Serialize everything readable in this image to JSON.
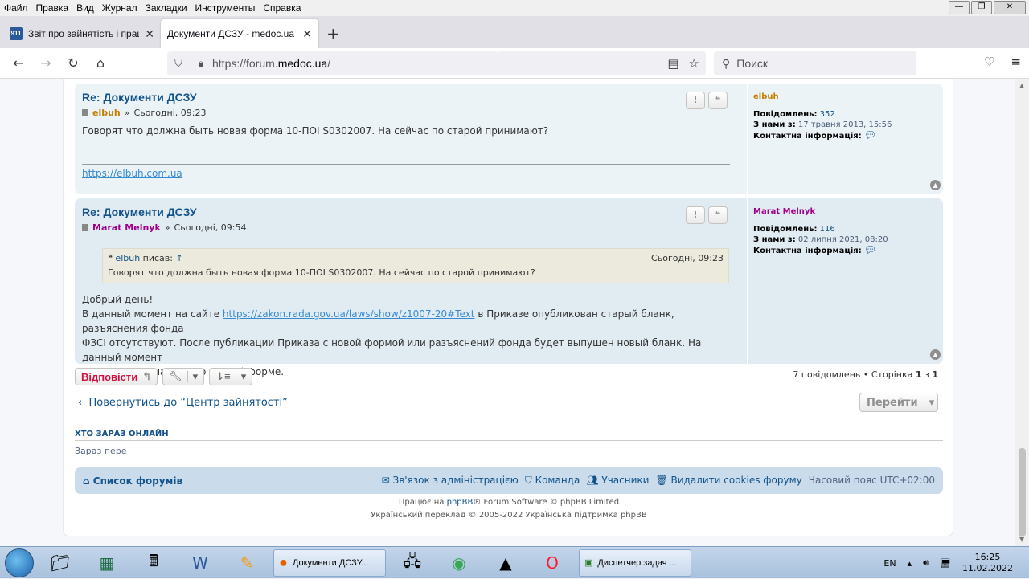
{
  "menu": [
    "Файл",
    "Правка",
    "Вид",
    "Журнал",
    "Закладки",
    "Инструменты",
    "Справка"
  ],
  "tabs": [
    {
      "title": "Звіт про зайнятість і працевла",
      "favicon": "911"
    },
    {
      "title": "Документи ДСЗУ - medoc.ua",
      "favicon": "M"
    }
  ],
  "url": {
    "prefix": "https://forum.",
    "domain": "medoc.ua",
    "suffix": "/"
  },
  "search_placeholder": "Поиск",
  "posts": [
    {
      "title": "Re: Документи ДСЗУ",
      "author": "elbuh",
      "author_color": "#c47d00",
      "date": "Сьогодні, 09:23",
      "body": "Говорят что должна быть новая форма 10-ПОІ S0302007. На сейчас по старой принимают?",
      "signature": "https://elbuh.com.ua",
      "profile": {
        "name": "elbuh",
        "posts_label": "Повідомлень:",
        "posts": "352",
        "since_label": "З нами з:",
        "since": "17 травня 2013, 15:56",
        "contact_label": "Контактна інформація:"
      }
    },
    {
      "title": "Re: Документи ДСЗУ",
      "author": "Marat Melnyk",
      "author_color": "#a0008a",
      "date": "Сьогодні, 09:54",
      "quote": {
        "author": "elbuh",
        "wrote": "писав:",
        "arrow": "↑",
        "date": "Сьогодні, 09:23",
        "text": "Говорят что должна быть новая форма 10-ПОІ S0302007. На сейчас по старой принимают?"
      },
      "body1": "Добрый день!",
      "body2_pre": "В данный момент на сайте ",
      "body2_link": "https://zakon.rada.gov.ua/laws/show/z1007-20#Text",
      "body2_post": " в Приказе опубликован старый бланк, разъяснения фонда",
      "body3": "ФЗСІ отсутствуют. После публикации Приказа с новой формой или разъяснений фонда будет выпущен новый бланк. На данный момент",
      "body4": "отчеты принимаются по старой форме.",
      "profile": {
        "name": "Marat Melnyk",
        "posts_label": "Повідомлень:",
        "posts": "116",
        "since_label": "З нами з:",
        "since": "02 липня 2021, 08:20",
        "contact_label": "Контактна інформація:"
      }
    }
  ],
  "reply_label": "Відповісти",
  "pager": {
    "count": "7 повідомлень",
    "sep": "•",
    "page_label": "Сторінка",
    "cur": "1",
    "of": "з",
    "total": "1"
  },
  "back_label": "Повернутись до “Центр зайнятості”",
  "goto_label": "Перейти",
  "online_title": "ХТО ЗАРАЗ ОНЛАЙН",
  "online_text": "Зараз пере",
  "footer_nav": {
    "index": "Список форумів",
    "contact": "Зв'язок з адміністрацією",
    "team": "Команда",
    "members": "Учасники",
    "cookies": "Видалити cookies форуму",
    "timezone": "Часовий пояс UTC+02:00"
  },
  "copyright1": {
    "pre": "Працює на ",
    "brand": "phpBB",
    "post": "® Forum Software © phpBB Limited"
  },
  "copyright2": "Український переклад © 2005-2022  Українська підтримка phpBB",
  "taskbar": {
    "firefox_window": "Документи ДСЗУ...",
    "taskmgr_window": "Диспетчер задач ...",
    "lang": "EN",
    "time": "16:25",
    "date": "11.02.2022"
  }
}
